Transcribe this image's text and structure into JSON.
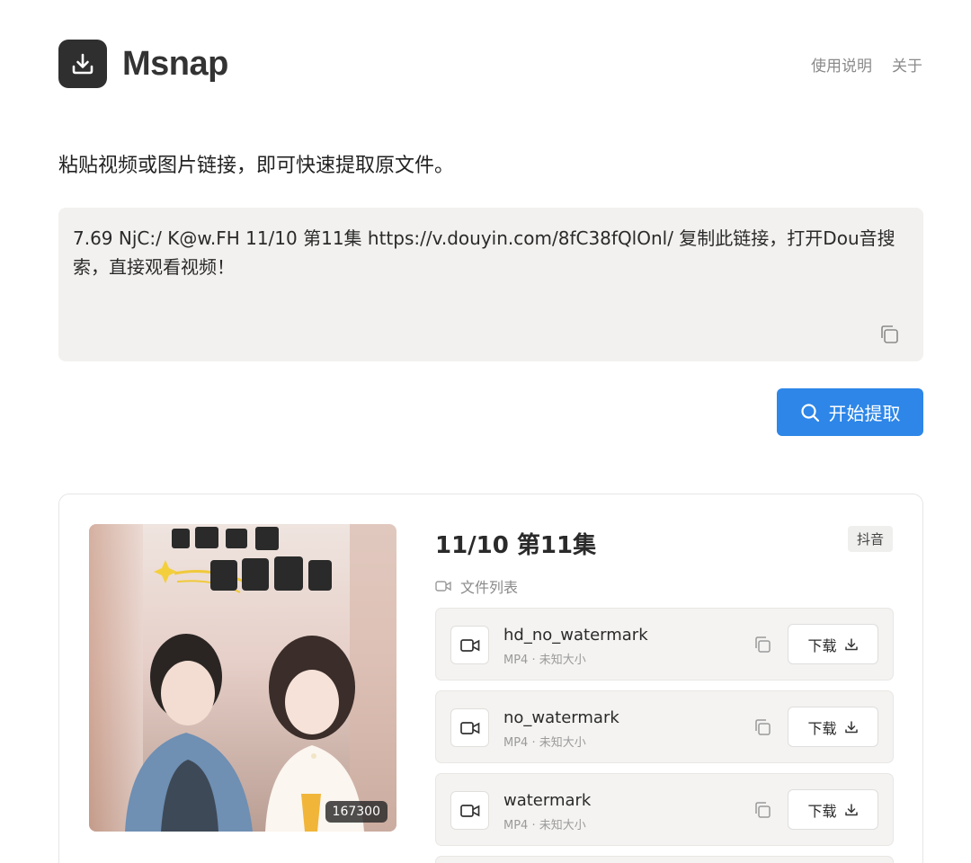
{
  "header": {
    "brand": "Msnap",
    "nav": [
      "使用说明",
      "关于"
    ]
  },
  "tagline": "粘贴视频或图片链接，即可快速提取原文件。",
  "input": {
    "value": "7.69 NjC:/ K@w.FH 11/10 第11集   https://v.douyin.com/8fC38fQlOnl/ 复制此链接，打开Dou音搜索，直接观看视频！"
  },
  "extract_button": "开始提取",
  "result": {
    "title": "11/10 第11集",
    "platform_badge": "抖音",
    "thumbnail_count": "167300",
    "files_label": "文件列表",
    "download_label": "下载",
    "files": [
      {
        "name": "hd_no_watermark",
        "meta": "MP4 · 未知大小"
      },
      {
        "name": "no_watermark",
        "meta": "MP4 · 未知大小"
      },
      {
        "name": "watermark",
        "meta": "MP4 · 未知大小"
      }
    ]
  },
  "colors": {
    "accent": "#2d86e8",
    "logo_bg": "#2f2f2f",
    "input_bg": "#f2f1ef"
  }
}
